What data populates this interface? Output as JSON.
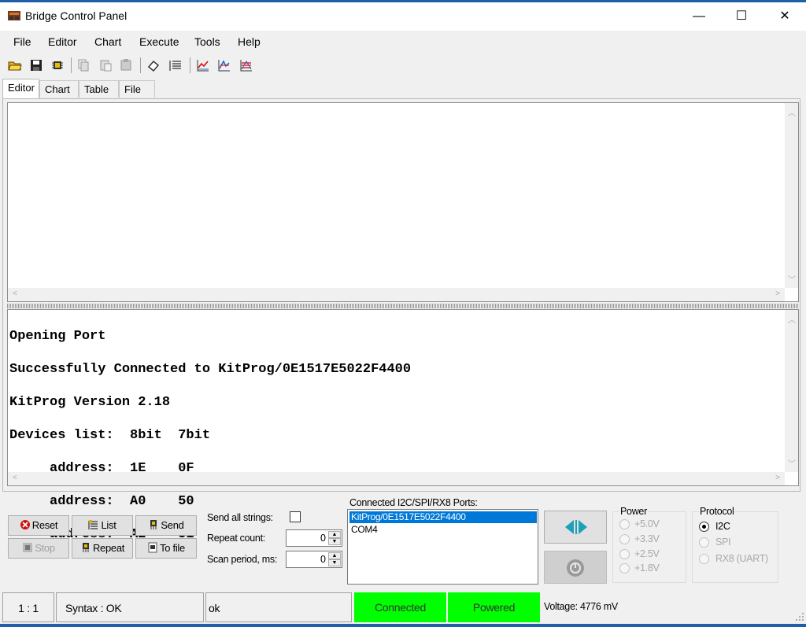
{
  "window": {
    "title": "Bridge Control Panel",
    "minimize_glyph": "—",
    "maximize_glyph": "☐",
    "close_glyph": "✕"
  },
  "menu": [
    "File",
    "Editor",
    "Chart",
    "Execute",
    "Tools",
    "Help"
  ],
  "toolbar_icons": [
    "open-folder-icon",
    "save-icon",
    "chip-icon",
    "copy-icon",
    "paste-icon",
    "paste-special-icon",
    "eraser-icon",
    "list-icon",
    "chart-icon",
    "chart-xy-icon",
    "chart-multi-icon"
  ],
  "tabs": [
    "Editor",
    "Chart",
    "Table",
    "File"
  ],
  "active_tab": "Editor",
  "log": {
    "lines": [
      "Opening Port",
      "Successfully Connected to KitProg/0E1517E5022F4400",
      "KitProg Version 2.18",
      "Devices list:  8bit  7bit",
      "     address:  1E    0F",
      "     address:  A0    50",
      "     address:  A2    51"
    ]
  },
  "buttons": {
    "reset": "Reset",
    "list": "List",
    "send": "Send",
    "stop": "Stop",
    "repeat": "Repeat",
    "to_file": "To file"
  },
  "options": {
    "send_all_label": "Send all strings:",
    "send_all_checked": false,
    "repeat_label": "Repeat count:",
    "repeat_value": "0",
    "scan_label": "Scan period, ms:",
    "scan_value": "0"
  },
  "ports": {
    "label": "Connected I2C/SPI/RX8 Ports:",
    "items": [
      "KitProg/0E1517E5022F4400",
      "COM4"
    ],
    "selected": "KitProg/0E1517E5022F4400"
  },
  "power": {
    "title": "Power",
    "options": [
      "+5.0V",
      "+3.3V",
      "+2.5V",
      "+1.8V"
    ]
  },
  "protocol": {
    "title": "Protocol",
    "options": [
      "I2C",
      "SPI",
      "RX8 (UART)"
    ],
    "selected": "I2C"
  },
  "status": {
    "position": "1 : 1",
    "syntax": "Syntax : OK",
    "message": "ok",
    "connected": "Connected",
    "powered": "Powered",
    "voltage": "Voltage: 4776 mV"
  },
  "colors": {
    "status_green": "#00ff00",
    "selection_blue": "#0078d7",
    "connect_arrow": "#1fa0b8"
  }
}
